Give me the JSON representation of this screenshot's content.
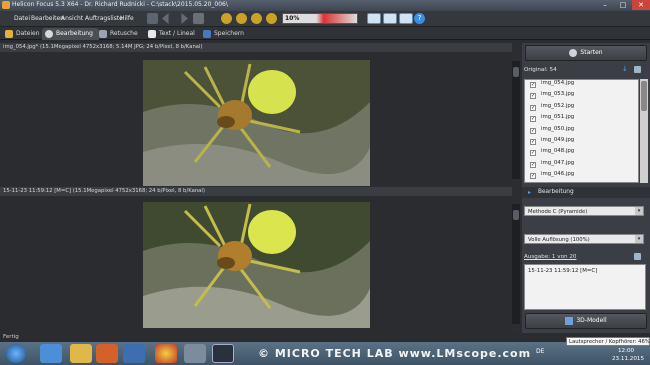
{
  "window": {
    "title": "Helicon Focus 5.3 X64 - Dr. Richard Rudnicki - C:\\stack\\2015.05.20_006\\"
  },
  "menu": [
    "Datei",
    "Bearbeiten",
    "Ansicht",
    "Auftragsliste",
    "Hilfe"
  ],
  "toolbar": {
    "zoom_value": "10%"
  },
  "tabs": [
    "Dateien",
    "Bearbeitung",
    "Retusche",
    "Text / Lineal",
    "Speichern"
  ],
  "pane_top": {
    "header": "img_054.jpg* (15.1Megapixel 4752x3168; 5.14M JPG; 24 b/Pixel, 8 b/Kanal)"
  },
  "pane_bottom": {
    "header": "15-11-23 11:59:12 [M=C] (15.1Megapixel 4752x3168; 24 b/Pixel, 8 b/Kanal)"
  },
  "right": {
    "start_label": "Starten",
    "original_label": "Original: 54",
    "files": [
      "img_054.jpg",
      "img_053.jpg",
      "img_052.jpg",
      "img_051.jpg",
      "img_050.jpg",
      "img_049.jpg",
      "img_048.jpg",
      "img_047.jpg",
      "img_046.jpg"
    ],
    "section_label": "Bearbeitung",
    "method": "Methode C (Pyramide)",
    "resolution": "Volle Auflösung (100%)",
    "output_label": "Ausgabe: 1 von 20",
    "output_item": "15-11-23 11:59:12 [M=C]",
    "model_label": "3D-Modell"
  },
  "status": {
    "text": "Fertig"
  },
  "taskbar": {
    "tooltip": "Lautsprecher / Kopfhörer: 46%",
    "lang": "DE",
    "time": "12:00",
    "date": "23.11.2015"
  },
  "watermark": "© MICRO TECH LAB  www.LMscope.com"
}
